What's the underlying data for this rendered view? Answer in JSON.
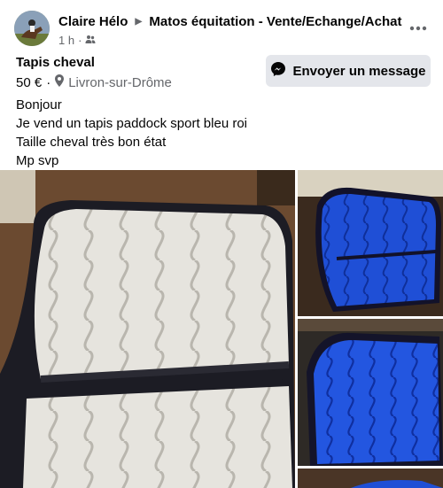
{
  "post": {
    "author": "Claire Hélo",
    "group": "Matos équitation - Vente/Echange/Achat",
    "time": "1 h",
    "separator": "·"
  },
  "listing": {
    "title": "Tapis cheval",
    "price": "50 €",
    "price_separator": "·",
    "location": "Livron-sur-Drôme",
    "message_button": "Envoyer un message"
  },
  "description": {
    "lines": [
      "Bonjour",
      "Je vend un tapis paddock sport bleu roi",
      "Taille cheval très bon état",
      "Mp svp"
    ]
  },
  "icons": {
    "group_arrow": "triangle-right-icon",
    "audience": "group-audience-icon",
    "location": "location-pin-icon",
    "messenger": "messenger-icon",
    "more": "more-options-icon"
  },
  "colors": {
    "secondary_text": "#65676b",
    "button_bg": "#e4e6eb",
    "saddle_pad_white": "#e8e6e0",
    "saddle_pad_blue": "#1f4fd6",
    "saddle_pad_trim": "#1a1a2e"
  }
}
